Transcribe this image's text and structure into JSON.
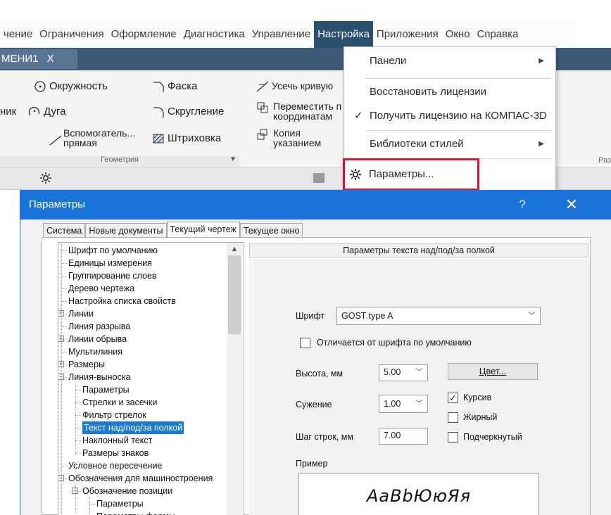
{
  "menubar": {
    "items": [
      "чение",
      "Ограничения",
      "Оформление",
      "Диагностика",
      "Управление",
      "Настройка",
      "Приложения",
      "Окно",
      "Справка"
    ],
    "active_index": 5
  },
  "doc_tab": {
    "label": "МЕНИ1",
    "close": "X"
  },
  "ribbon": {
    "circle": "Окружность",
    "chamfer": "Фаска",
    "arc_prefix": "ник",
    "arc": "Дуга",
    "fillet": "Скругление",
    "aux_line_1": "Вспомогатель...",
    "aux_line_2": "прямая",
    "hatch": "Штриховка",
    "trim": "Усечь кривую",
    "move_1": "Переместить п",
    "move_2": "координатам",
    "copy_1": "Копия",
    "copy_2": "указанием",
    "group_label": "Геометрия",
    "right_partial": "Раз"
  },
  "dropdown": {
    "panels": "Панели",
    "restore": "Восстановить лицензии",
    "get_license": "Получить лицензию на КОМПАС-3D",
    "style_libs": "Библиотеки стилей",
    "params": "Параметры..."
  },
  "dialog": {
    "title": "Параметры",
    "help": "?",
    "close": "✕",
    "tabs": [
      "Система",
      "Новые документы",
      "Текущий чертеж",
      "Текущее окно"
    ],
    "selected_tab": 2,
    "tree": [
      {
        "label": "Шрифт по умолчанию",
        "level": 0
      },
      {
        "label": "Единицы измерения",
        "level": 0
      },
      {
        "label": "Группирование слоев",
        "level": 0
      },
      {
        "label": "Дерево чертежа",
        "level": 0
      },
      {
        "label": "Настройка списка свойств",
        "level": 0
      },
      {
        "label": "Линии",
        "level": 0,
        "expander": "+"
      },
      {
        "label": "Линия разрыва",
        "level": 0
      },
      {
        "label": "Линии обрыва",
        "level": 0,
        "expander": "+"
      },
      {
        "label": "Мультилиния",
        "level": 0
      },
      {
        "label": "Размеры",
        "level": 0,
        "expander": "+"
      },
      {
        "label": "Линия-выноска",
        "level": 0,
        "expander": "−"
      },
      {
        "label": "Параметры",
        "level": 1
      },
      {
        "label": "Стрелки и засечки",
        "level": 1
      },
      {
        "label": "Фильтр стрелок",
        "level": 1
      },
      {
        "label": "Текст над/под/за полкой",
        "level": 1,
        "selected": true
      },
      {
        "label": "Наклонный текст",
        "level": 1
      },
      {
        "label": "Размеры знаков",
        "level": 1
      },
      {
        "label": "Условное пересечение",
        "level": 0
      },
      {
        "label": "Обозначения для машиностроения",
        "level": 0,
        "expander": "−"
      },
      {
        "label": "Обозначение позиции",
        "level": 1,
        "expander": "−"
      },
      {
        "label": "Параметры",
        "level": 2
      },
      {
        "label": "Параметры формы",
        "level": 2
      }
    ],
    "panel": {
      "header": "Параметры текста над/под/за полкой",
      "font_label": "Шрифт",
      "font_value": "GOST type A",
      "differs_label": "Отличается от шрифта по умолчанию",
      "height_label": "Высота, мм",
      "height_value": "5.00",
      "color_button": "Цвет...",
      "narrow_label": "Сужение",
      "narrow_value": "1.00",
      "italic_label": "Курсив",
      "bold_label": "Жирный",
      "underline_label": "Подчеркнутый",
      "step_label": "Шаг строк, мм",
      "step_value": "7.00",
      "sample_label": "Пример",
      "sample_text": "АаBbЮюЯя",
      "italic_checked": "✓"
    }
  }
}
